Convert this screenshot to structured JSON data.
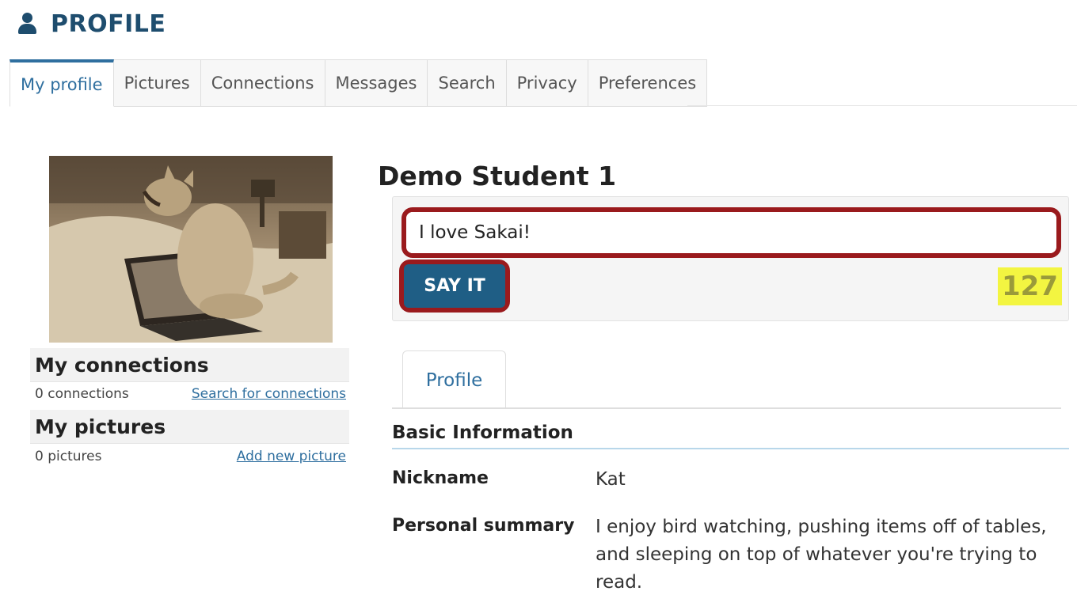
{
  "header": {
    "icon": "user-icon",
    "title": "PROFILE"
  },
  "tabs": [
    {
      "label": "My profile",
      "active": true
    },
    {
      "label": "Pictures"
    },
    {
      "label": "Connections"
    },
    {
      "label": "Messages"
    },
    {
      "label": "Search"
    },
    {
      "label": "Privacy"
    },
    {
      "label": "Preferences"
    }
  ],
  "sidebar": {
    "connections": {
      "heading": "My connections",
      "count": "0 connections",
      "link": "Search for connections"
    },
    "pictures": {
      "heading": "My pictures",
      "count": "0 pictures",
      "link": "Add new picture"
    }
  },
  "profile": {
    "name": "Demo Student 1",
    "status": {
      "value": "I love Sakai!",
      "button": "SAY IT",
      "remaining": "127"
    },
    "subtab": "Profile",
    "section": "Basic Information",
    "fields": [
      {
        "label": "Nickname",
        "value": "Kat"
      },
      {
        "label": "Personal summary",
        "value": "I enjoy bird watching, pushing items off of tables, and sleeping on top of whatever you're trying to read."
      }
    ]
  },
  "colors": {
    "accent": "#1e4d6e",
    "link": "#2f6f9f",
    "highlight_border": "#9a1a1d",
    "counter_bg": "#f3f541"
  }
}
